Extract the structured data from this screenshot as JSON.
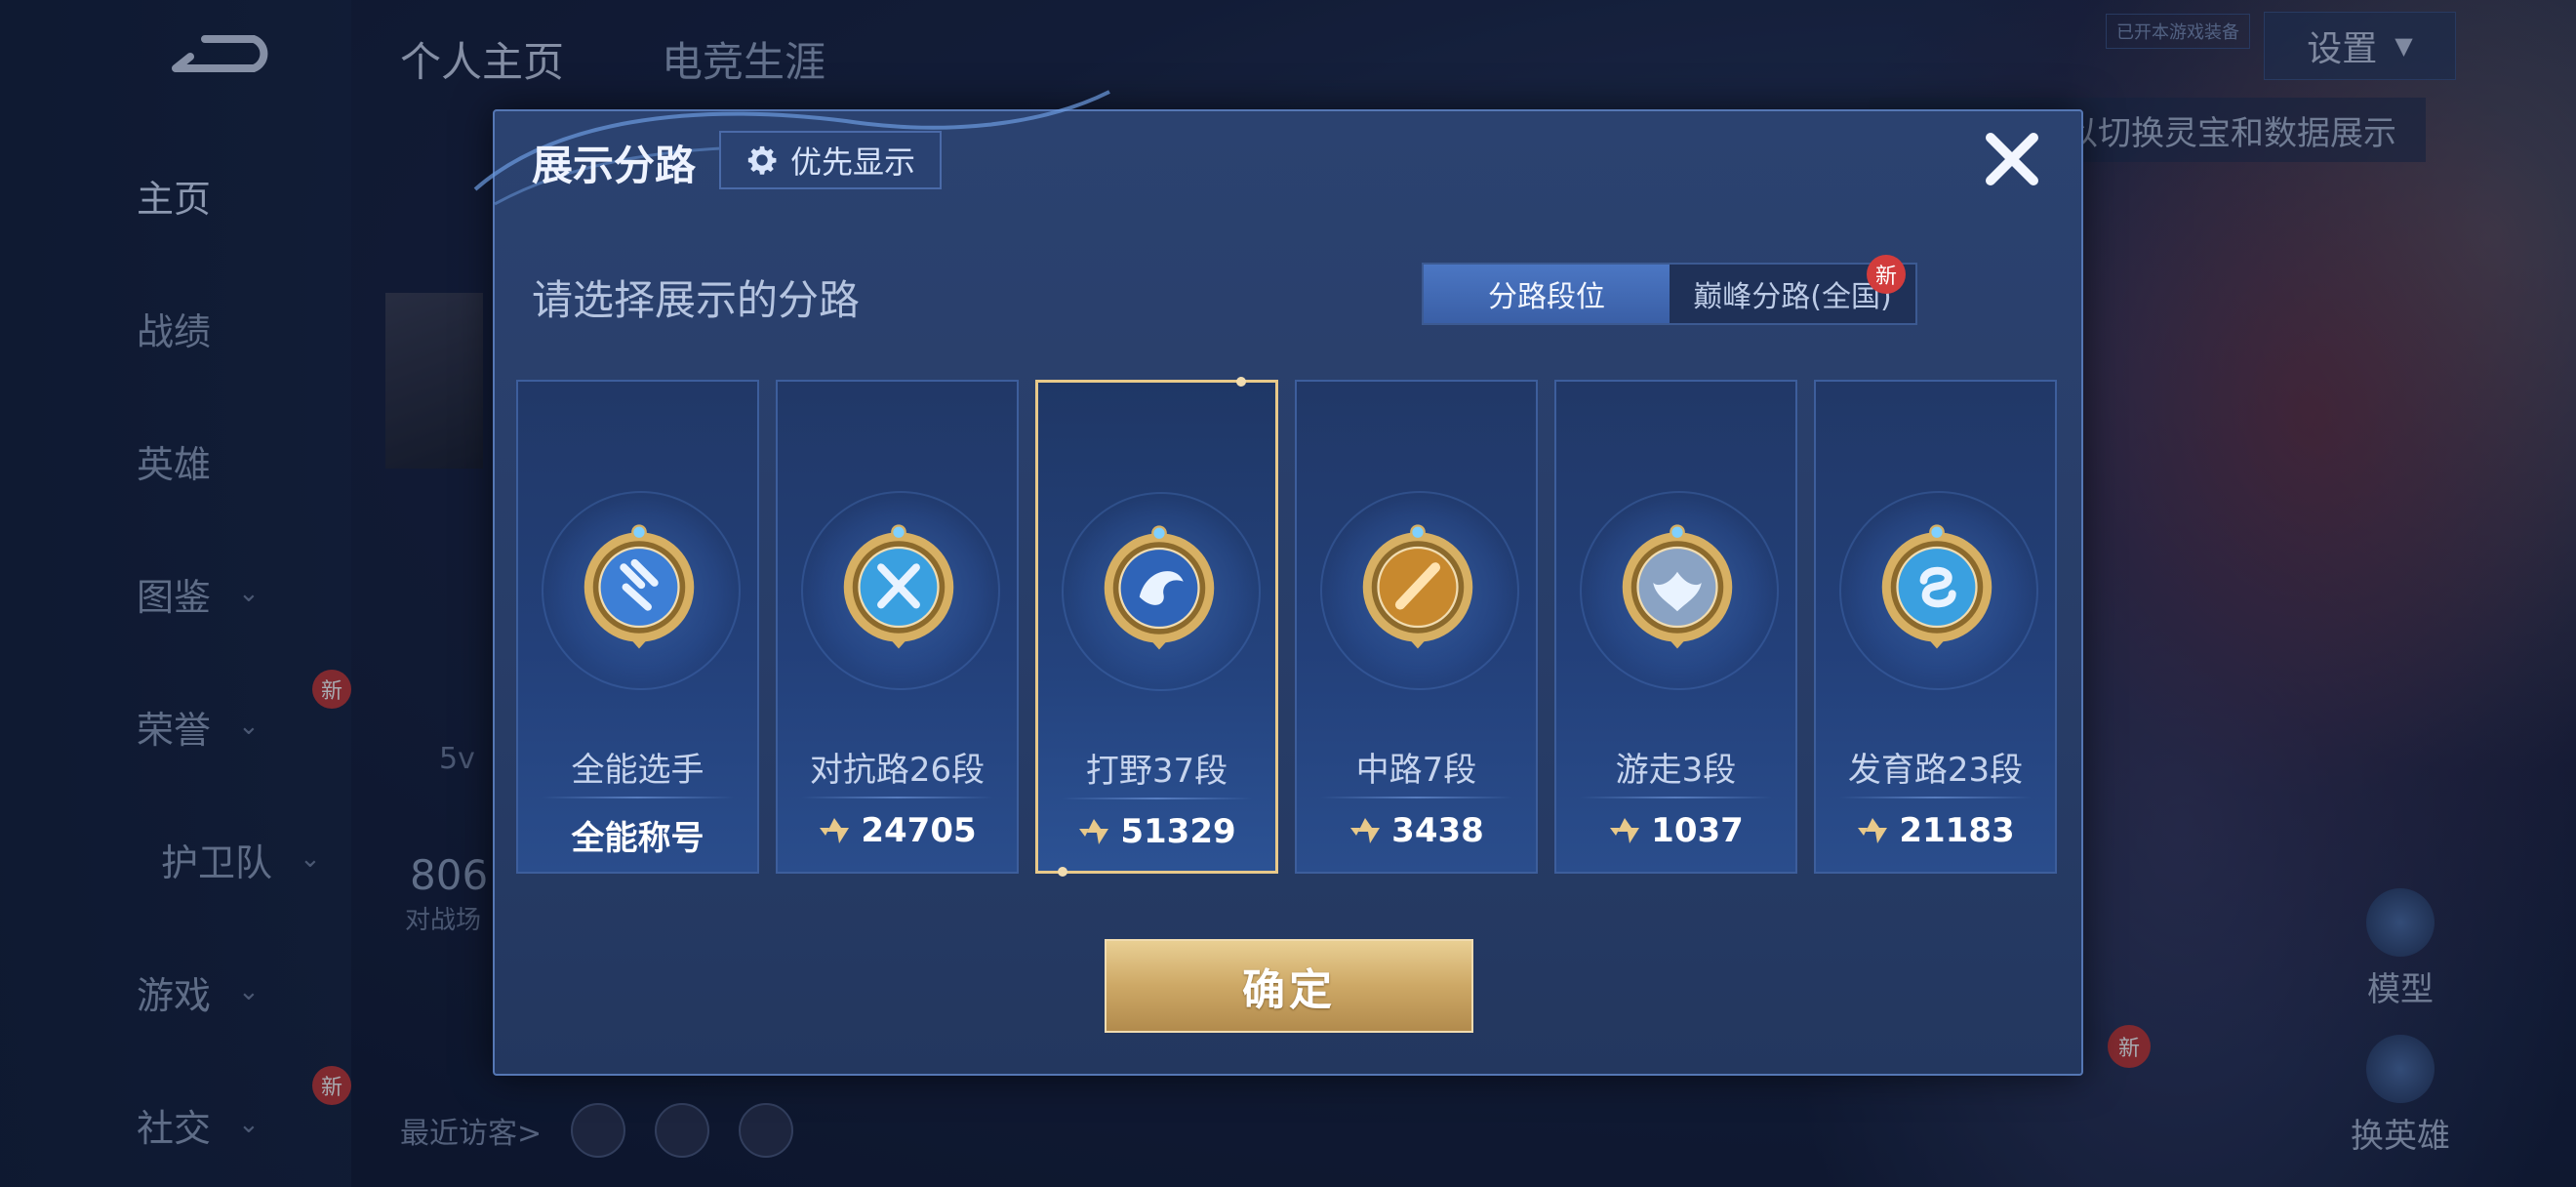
{
  "sidebar": {
    "items": [
      {
        "label": "主页",
        "active": true
      },
      {
        "label": "战绩"
      },
      {
        "label": "英雄"
      },
      {
        "label": "图鉴"
      },
      {
        "label": "荣誉",
        "badge": "新"
      },
      {
        "label": "护卫队"
      },
      {
        "label": "游戏"
      },
      {
        "label": "社交",
        "badge": "新"
      }
    ]
  },
  "top_tabs": [
    "个人主页",
    "电竞生涯"
  ],
  "settings_label": "设置",
  "tiny_tag": "已开本游戏装备",
  "switch_hint": "以切换灵宝和数据展示",
  "background": {
    "stat_value": "806",
    "stat_label": "对战场",
    "visitors_label": "最近访客>",
    "model_label": "模型",
    "change_hero_label": "换英雄",
    "partial_text": "5v",
    "new_badge": "新"
  },
  "modal": {
    "title": "展示分路",
    "priority_label": "优先显示",
    "subtitle": "请选择展示的分路",
    "segments": [
      {
        "label": "分路段位",
        "active": true
      },
      {
        "label": "巅峰分路(全国)",
        "badge": "新"
      }
    ],
    "cards": [
      {
        "name": "全能选手",
        "value": "全能称号",
        "has_icon": false,
        "emblem": "all-round-emblem",
        "selected": false
      },
      {
        "name": "对抗路26段",
        "value": "24705",
        "has_icon": true,
        "emblem": "clash-lane-emblem",
        "selected": false
      },
      {
        "name": "打野37段",
        "value": "51329",
        "has_icon": true,
        "emblem": "jungle-emblem",
        "selected": true
      },
      {
        "name": "中路7段",
        "value": "3438",
        "has_icon": true,
        "emblem": "mid-lane-emblem",
        "selected": false
      },
      {
        "name": "游走3段",
        "value": "1037",
        "has_icon": true,
        "emblem": "roam-emblem",
        "selected": false
      },
      {
        "name": "发育路23段",
        "value": "21183",
        "has_icon": true,
        "emblem": "farm-lane-emblem",
        "selected": false
      }
    ],
    "confirm_label": "确定"
  },
  "colors": {
    "accent_gold": "#e8c98a",
    "panel_blue": "#283d68",
    "badge_red": "#d23c3c"
  }
}
